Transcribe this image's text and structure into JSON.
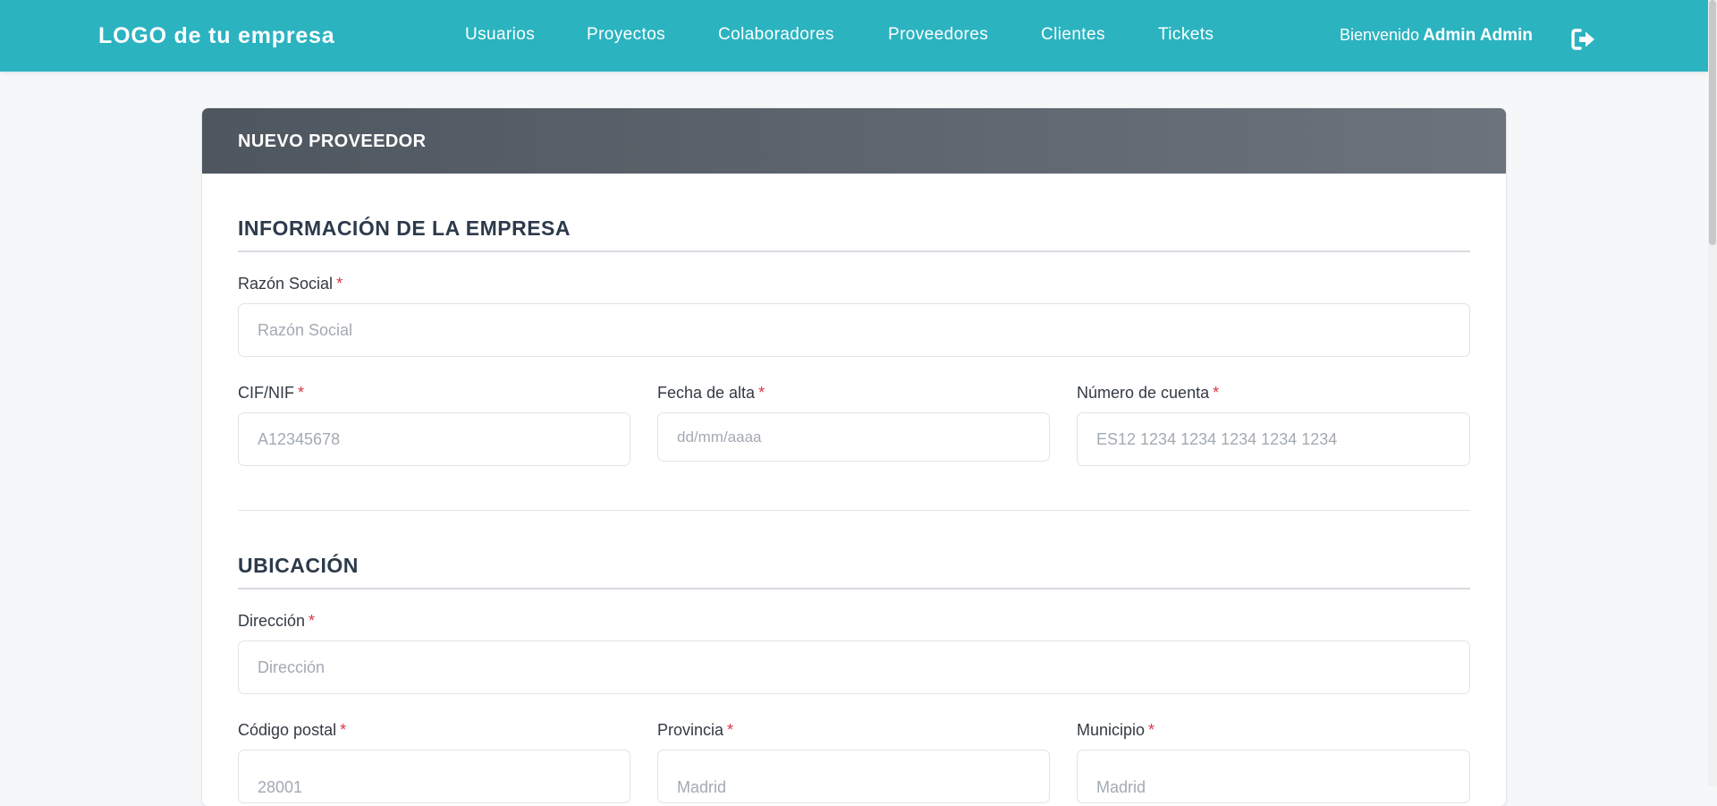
{
  "navbar": {
    "logo": "LOGO de tu empresa",
    "links": [
      "Usuarios",
      "Proyectos",
      "Colaboradores",
      "Proveedores",
      "Clientes",
      "Tickets"
    ],
    "welcome_text": "Bienvenido",
    "user_name": "Admin Admin",
    "logout_icon": "logout-icon"
  },
  "colors": {
    "navbar": "#2bb3c0",
    "header_gradient_start": "#4e565f",
    "header_gradient_end": "#6b737c",
    "required": "#dc3545"
  },
  "form": {
    "title": "NUEVO PROVEEDOR",
    "required_mark": "*",
    "company": {
      "title": "INFORMACIÓN DE LA EMPRESA",
      "razon_social": {
        "label": "Razón Social",
        "placeholder": "Razón Social"
      },
      "cif": {
        "label": "CIF/NIF",
        "placeholder": "A12345678"
      },
      "fecha_alta": {
        "label": "Fecha de alta",
        "placeholder": "dd/mm/aaaa"
      },
      "cuenta": {
        "label": "Número de cuenta",
        "placeholder": "ES12 1234 1234 1234 1234 1234"
      }
    },
    "location": {
      "title": "UBICACIÓN",
      "direccion": {
        "label": "Dirección",
        "placeholder": "Dirección"
      },
      "codigo_postal": {
        "label": "Código postal",
        "placeholder": "28001"
      },
      "provincia": {
        "label": "Provincia",
        "placeholder": "Madrid"
      },
      "municipio": {
        "label": "Municipio",
        "placeholder": "Madrid"
      }
    }
  }
}
